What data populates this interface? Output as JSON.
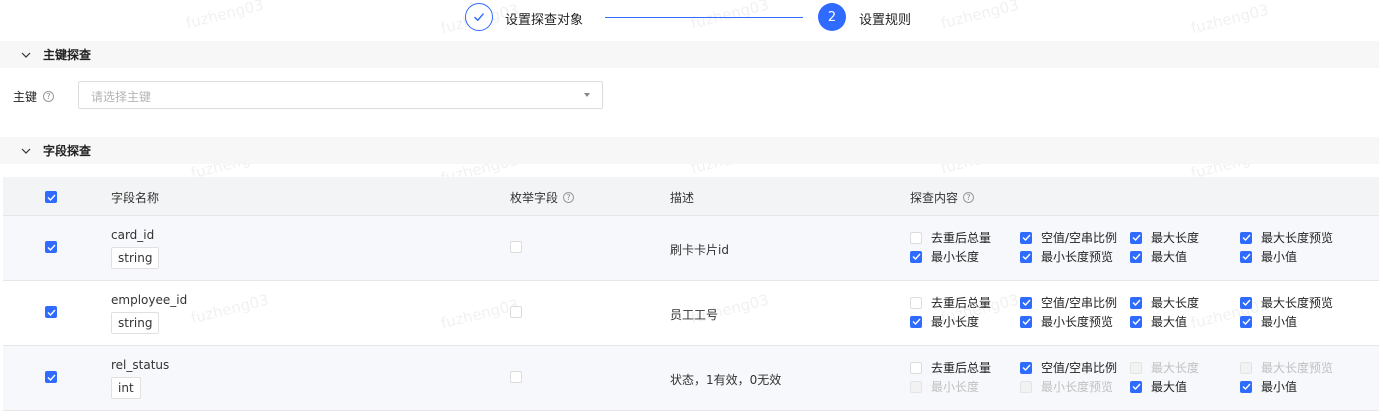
{
  "steps": [
    {
      "label": "设置探查对象",
      "state": "done"
    },
    {
      "label": "设置规则",
      "number": "2",
      "state": "active"
    }
  ],
  "watermark": "fuzheng03",
  "sections": {
    "pk": {
      "title": "主键探查"
    },
    "fields": {
      "title": "字段探查"
    }
  },
  "pk": {
    "label": "主键",
    "placeholder": "请选择主键"
  },
  "table": {
    "headers": {
      "name": "字段名称",
      "enum": "枚举字段",
      "desc": "描述",
      "content": "探查内容"
    },
    "all_checked": true,
    "rows": [
      {
        "selected": true,
        "name": "card_id",
        "type": "string",
        "enum": false,
        "desc": "刷卡卡片id",
        "options": [
          {
            "label": "去重后总量",
            "state": "off"
          },
          {
            "label": "空值/空串比例",
            "state": "on"
          },
          {
            "label": "最大长度",
            "state": "on"
          },
          {
            "label": "最大长度预览",
            "state": "on"
          },
          {
            "label": "最小长度",
            "state": "on"
          },
          {
            "label": "最小长度预览",
            "state": "on"
          },
          {
            "label": "最大值",
            "state": "on"
          },
          {
            "label": "最小值",
            "state": "on"
          }
        ]
      },
      {
        "selected": true,
        "name": "employee_id",
        "type": "string",
        "enum": false,
        "desc": "员工工号",
        "options": [
          {
            "label": "去重后总量",
            "state": "off"
          },
          {
            "label": "空值/空串比例",
            "state": "on"
          },
          {
            "label": "最大长度",
            "state": "on"
          },
          {
            "label": "最大长度预览",
            "state": "on"
          },
          {
            "label": "最小长度",
            "state": "on"
          },
          {
            "label": "最小长度预览",
            "state": "on"
          },
          {
            "label": "最大值",
            "state": "on"
          },
          {
            "label": "最小值",
            "state": "on"
          }
        ]
      },
      {
        "selected": true,
        "name": "rel_status",
        "type": "int",
        "enum": false,
        "desc": "状态，1有效，0无效",
        "options": [
          {
            "label": "去重后总量",
            "state": "off"
          },
          {
            "label": "空值/空串比例",
            "state": "on"
          },
          {
            "label": "最大长度",
            "state": "dis"
          },
          {
            "label": "最大长度预览",
            "state": "dis"
          },
          {
            "label": "最小长度",
            "state": "dis"
          },
          {
            "label": "最小长度预览",
            "state": "dis"
          },
          {
            "label": "最大值",
            "state": "on"
          },
          {
            "label": "最小值",
            "state": "on"
          }
        ]
      }
    ]
  },
  "colors": {
    "accent": "#2f6bff"
  }
}
